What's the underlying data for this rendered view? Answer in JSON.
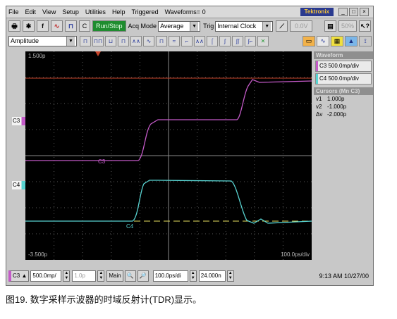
{
  "menu": {
    "items": [
      "File",
      "Edit",
      "View",
      "Setup",
      "Utilities",
      "Help",
      "Triggered",
      "Waveforms= 0"
    ],
    "brand": "Tektronix"
  },
  "toolbar": {
    "c_label": "C",
    "run_stop": "Run/Stop",
    "acq_mode_label": "Acq Mode",
    "acq_mode_value": "Average",
    "trig_label": "Trig",
    "trig_value": "Internal Clock",
    "trig_level": "0.0V",
    "zoom": "50%"
  },
  "measure": {
    "select_value": "Amplitude"
  },
  "scope": {
    "top_left": "1.500p",
    "bottom_left": "-3.500p",
    "bottom_right": "100.0ps/div",
    "c3_label": "C3",
    "c4_label": "C4",
    "marker_c3": "C3",
    "marker_c4": "C4",
    "colors": {
      "c3": "#c45ac8",
      "c4": "#58d3d1",
      "cursor": "#c8442a",
      "ref": "#e8e060"
    }
  },
  "panel": {
    "waveform_header": "Waveform",
    "c3_button": "C3 500.0mp/div",
    "c4_button": "C4 500.0mp/div",
    "cursors_header": "Cursors (Mn C3)",
    "cursors": [
      {
        "k": "v1",
        "v": "1.000p"
      },
      {
        "k": "v2",
        "v": "-1.000p"
      },
      {
        "k": "Δv",
        "v": "-2.000p"
      }
    ]
  },
  "bottom": {
    "channel": "C3",
    "vscale": "500.0mp/",
    "vpos": "1.0p",
    "main": "Main",
    "hscale": "100.0ps/di",
    "hpos": "24.000n",
    "time": "9:13 AM 10/27/00"
  },
  "caption": "图19. 数字采样示波器的时域反射计(TDR)显示。"
}
